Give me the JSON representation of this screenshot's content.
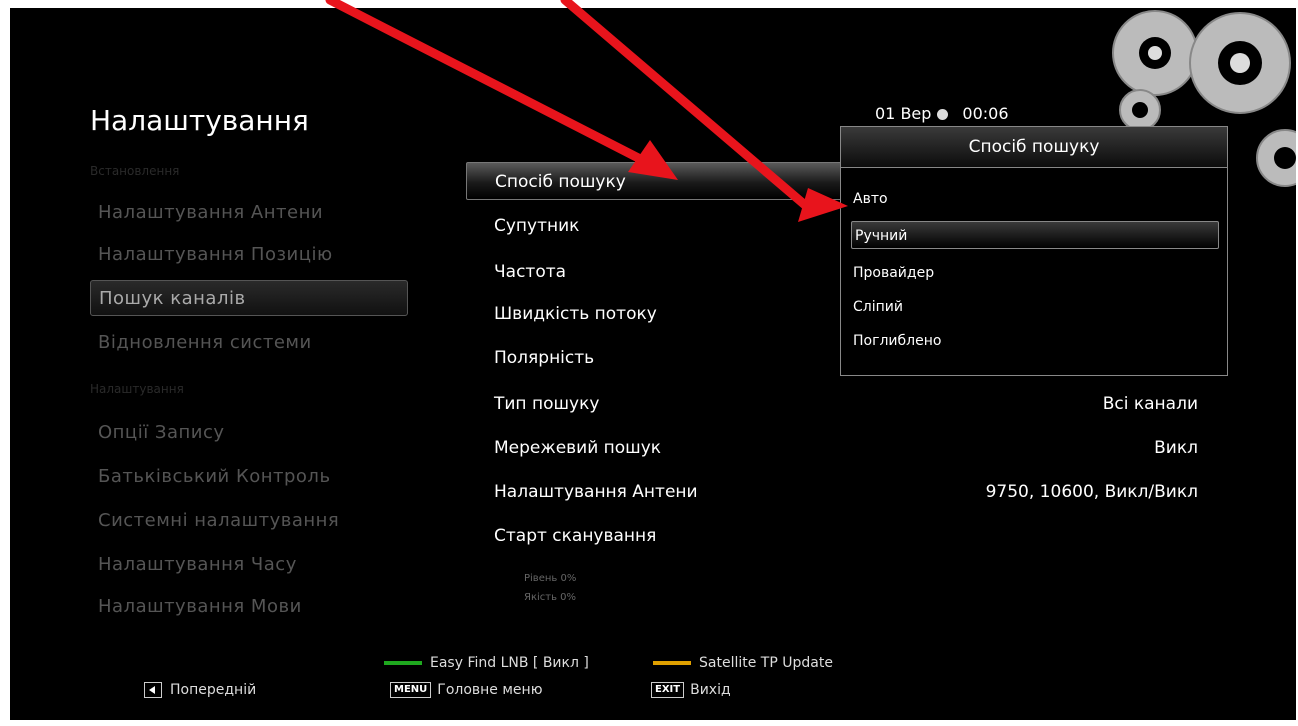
{
  "header": {
    "title": "Налаштування",
    "date": "01 Вер",
    "time": "00:06"
  },
  "sidebar": {
    "group1_label": "Встановлення",
    "group2_label": "Налаштування",
    "items": [
      "Налаштування Антени",
      "Налаштування Позицію",
      "Пошук каналів",
      "Відновлення системи",
      "Опції Запису",
      "Батьківський Контроль",
      "Системні налаштування",
      "Налаштування Часу",
      "Налаштування Мови"
    ]
  },
  "settings": {
    "rows": [
      {
        "label": "Спосіб пошуку",
        "value": ""
      },
      {
        "label": "Супутник",
        "value": ""
      },
      {
        "label": "Частота",
        "value": ""
      },
      {
        "label": "Швидкість потоку",
        "value": ""
      },
      {
        "label": "Полярність",
        "value": ""
      },
      {
        "label": "Тип пошуку",
        "value": "Всі канали"
      },
      {
        "label": "Мережевий пошук",
        "value": "Викл"
      },
      {
        "label": "Налаштування Антени",
        "value": "9750, 10600, Викл/Викл"
      },
      {
        "label": "Старт сканування",
        "value": ""
      }
    ],
    "level_label": "Рівень  0%",
    "quality_label": "Якість  0%"
  },
  "popup": {
    "title": "Спосіб пошуку",
    "options": [
      "Авто",
      "Ручний",
      "Провайдер",
      "Сліпий",
      "Поглиблено"
    ],
    "selected": "Ручний"
  },
  "footer": {
    "green_label": "Easy Find LNB [ Викл ]",
    "yellow_label": "Satellite TP Update",
    "prev_label": "Попередній",
    "menu_key": "MENU",
    "menu_label": "Головне меню",
    "exit_key": "EXIT",
    "exit_label": "Вихід"
  },
  "colors": {
    "background": "#000000",
    "annotation_arrow": "#e8141c",
    "green_key": "#1fa81f",
    "yellow_key": "#e0a000"
  }
}
